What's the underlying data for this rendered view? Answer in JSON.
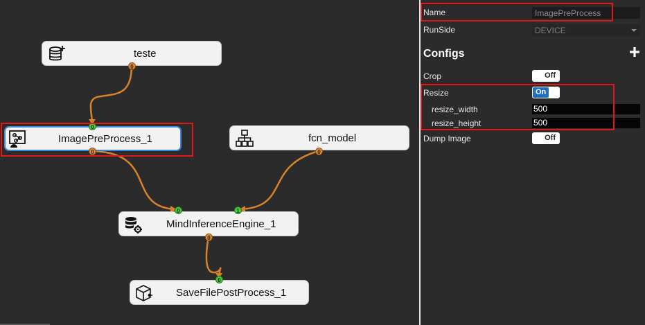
{
  "graph": {
    "nodes": [
      {
        "id": "teste",
        "label": "teste",
        "icon": "database-add-icon"
      },
      {
        "id": "imagepreprocess",
        "label": "ImagePreProcess_1",
        "icon": "image-process-icon"
      },
      {
        "id": "fcn",
        "label": "fcn_model",
        "icon": "hierarchy-icon"
      },
      {
        "id": "mind",
        "label": "MindInferenceEngine_1",
        "icon": "database-gear-icon"
      },
      {
        "id": "save",
        "label": "SaveFilePostProcess_1",
        "icon": "cube-export-icon"
      }
    ],
    "ports": {
      "teste_out": "0",
      "imagepre_in": "0",
      "imagepre_out": "0",
      "fcn_out": "0",
      "mind_in0": "0",
      "mind_in1": "1",
      "mind_out": "0",
      "save_in": "0"
    },
    "colors": {
      "link": "#d9822b",
      "port_out": "#e08a3c",
      "port_in": "#4ecb3c",
      "highlight": "#e01919"
    }
  },
  "properties": {
    "name_label": "Name",
    "name_value": "ImagePreProcess",
    "runside_label": "RunSide",
    "runside_value": "DEVICE",
    "configs_title": "Configs",
    "crop_label": "Crop",
    "crop_state": "Off",
    "resize_label": "Resize",
    "resize_state": "On",
    "resize_width_label": "resize_width",
    "resize_width_value": "500",
    "resize_height_label": "resize_height",
    "resize_height_value": "500",
    "dump_label": "Dump Image",
    "dump_state": "Off"
  }
}
